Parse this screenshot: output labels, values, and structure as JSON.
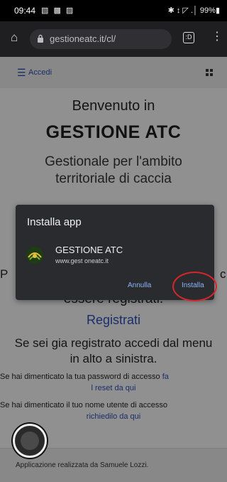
{
  "status_bar": {
    "time": "09:44",
    "left_icons": "▧ ▩ ▨",
    "right_icons": "✱ ↕ ◸ .│ 99%▮"
  },
  "browser": {
    "url": "gestioneatc.it/cl/",
    "tab_count": ":D"
  },
  "nav": {
    "menu_label": "Accedi"
  },
  "main": {
    "welcome": "Benvenuto in",
    "title": "GESTIONE ATC",
    "description": "Gestionale per l'ambito territoriale di caccia",
    "partial_left": "P",
    "partial_right": "c",
    "must_register": "essere registrati.",
    "register_link": "Registrati",
    "already_registered": "Se sei gia registrato accedi dal menu in alto a sinistra.",
    "forgot_password_text": "Se hai dimenticato la tua password di accesso",
    "forgot_password_link_a": "fa",
    "forgot_password_link_b": "l reset da qui",
    "forgot_username_text": "Se hai dimenticato il tuo nome utente di accesso",
    "forgot_username_link": "richiedilo da qui"
  },
  "footer": {
    "credit": "Applicazione realizzata da Samuele Lozzi."
  },
  "dialog": {
    "title": "Installa app",
    "app_name": "GESTIONE ATC",
    "app_url": "www.gest oneatc.it",
    "cancel_label": "Annulla",
    "install_label": "Installa"
  },
  "colors": {
    "link": "#2b4aa8",
    "dialog_button": "#8ab4f8",
    "highlight_ring": "#d4262b"
  }
}
